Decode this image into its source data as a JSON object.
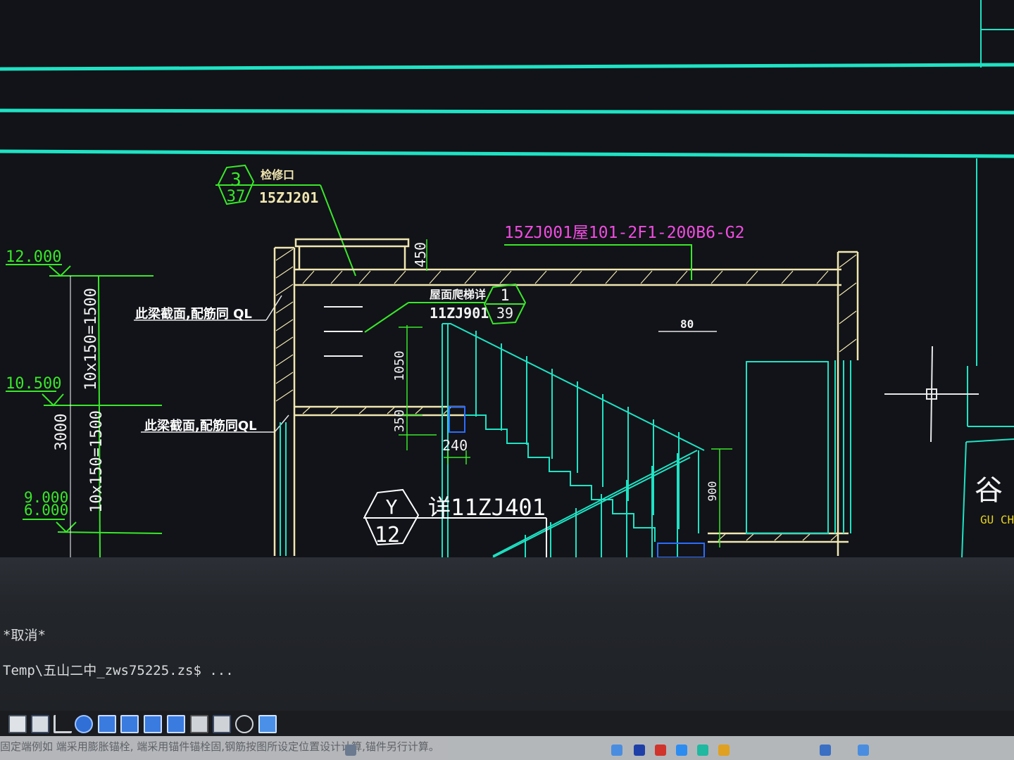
{
  "drawing": {
    "section_ref": {
      "number": "3",
      "sheet": "37",
      "note": "检修口",
      "atlas": "15ZJ201"
    },
    "roof_spec": "15ZJ001屋101-2F1-200B6-G2",
    "roof_ladder": {
      "label": "屋面爬梯详",
      "atlas": "11ZJ901",
      "number": "1",
      "sheet": "39"
    },
    "detail_y": {
      "number": "Y",
      "sheet": "12",
      "text": "详11ZJ401"
    },
    "beam_note_1": "此梁截面,配筋同 QL",
    "beam_note_2": "此梁截面,配筋同QL",
    "elevations": {
      "e1": "12.000",
      "e2": "10.500",
      "e3": "9.000",
      "e4": "6.000"
    },
    "dims": {
      "d1": "10x150=1500",
      "d2": "10x150=1500",
      "d3": "3000",
      "d4": "450",
      "d5": "1050",
      "d6": "350",
      "d7": "240",
      "d8": "900",
      "d9": "80"
    },
    "title_char": "谷",
    "title_roman": "GU CH"
  },
  "command": {
    "line1": "*取消*",
    "line2": "Temp\\五山二中_zws75225.zs$ ..."
  },
  "toolbar": {
    "buttons": [
      "grid-icon",
      "grid-display-icon",
      "ortho-icon",
      "polar-icon",
      "osnap-icon",
      "otrack-icon",
      "ducs-icon",
      "dyn-icon",
      "lineweight-icon",
      "transparency-icon",
      "selection-cycling-icon",
      "annotation-icon"
    ]
  },
  "status_hint": "固定端例如    端采用膨胀锚栓,    端采用锚件锚栓固,钢筋按图所设定位置设计计算,锚件另行计算。"
}
